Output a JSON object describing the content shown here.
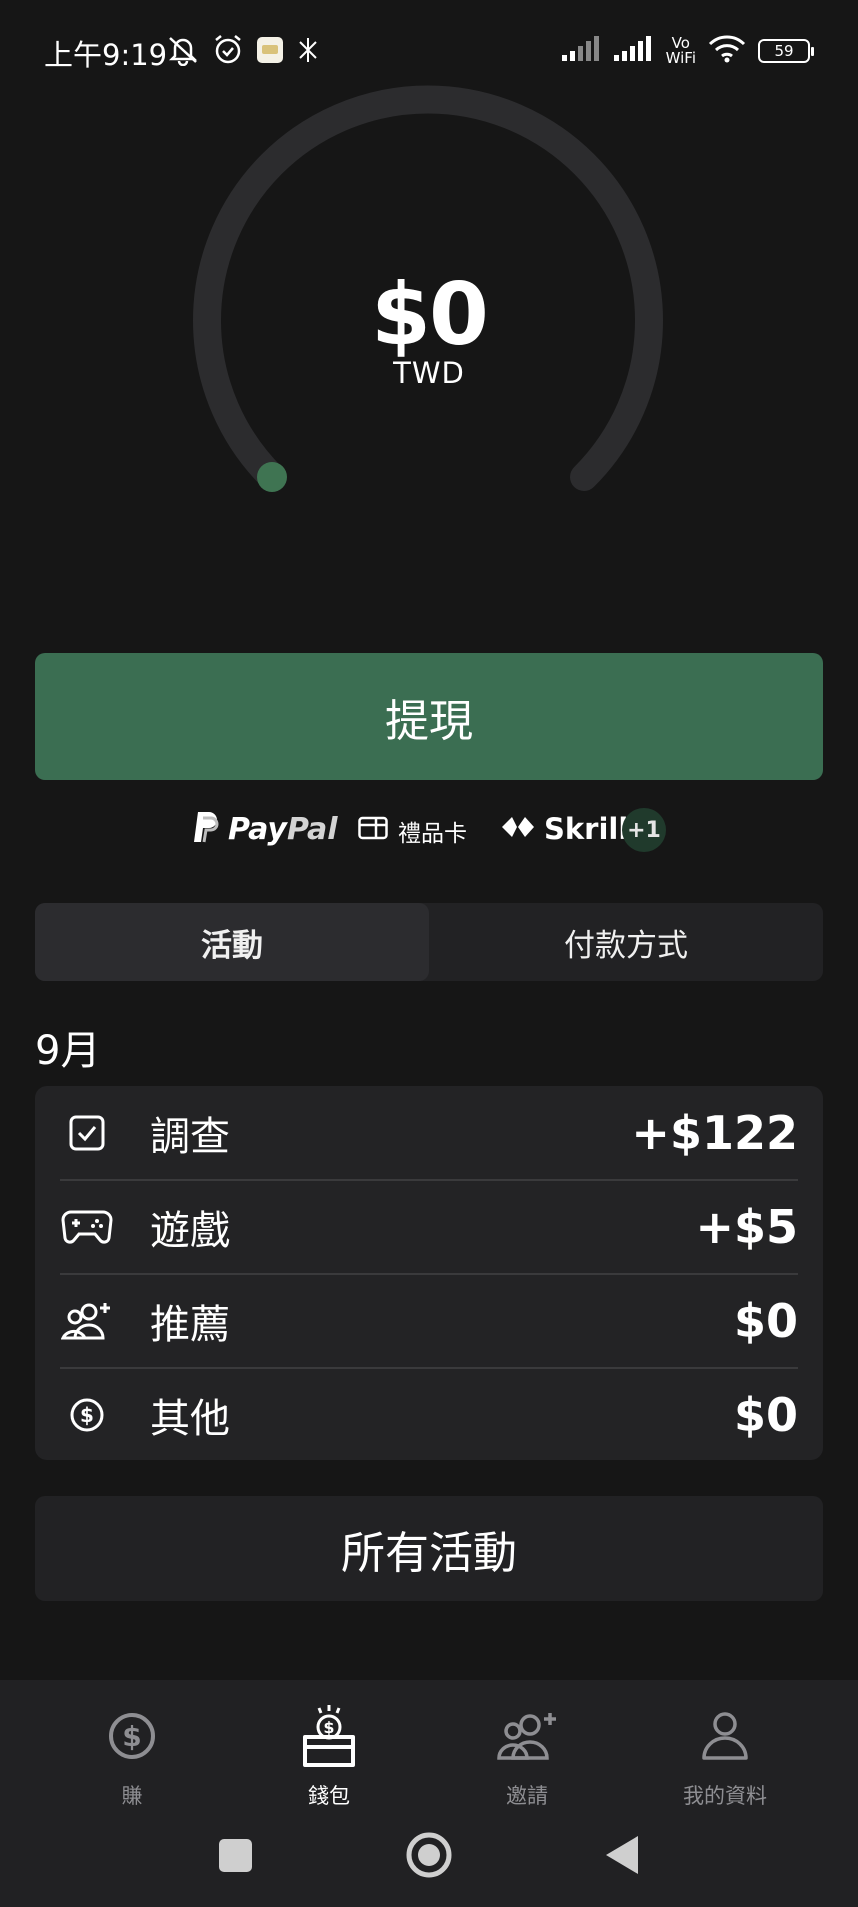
{
  "status_bar": {
    "time": "上午9:19",
    "vo_label": "Vo",
    "wifi_label": "WiFi",
    "battery": "59",
    "icons": [
      "mute-icon",
      "alarm-icon",
      "app-notification-icon",
      "nfc-icon",
      "signal-icon",
      "wifi-icon",
      "battery-icon"
    ]
  },
  "balance": {
    "amount": "$0",
    "currency": "TWD",
    "progress": 0
  },
  "withdraw_label": "提現",
  "payment_methods": {
    "paypal_pay": "Pay",
    "paypal_pal": "Pal",
    "giftcard": "禮品卡",
    "skrill": "Skrill",
    "more": "+1"
  },
  "tabs": [
    {
      "label": "活動",
      "active": true
    },
    {
      "label": "付款方式",
      "active": false
    }
  ],
  "month": "9月",
  "activity": [
    {
      "icon": "checkbox-icon",
      "label": "調查",
      "amount": "+$122"
    },
    {
      "icon": "gamepad-icon",
      "label": "遊戲",
      "amount": "+$5"
    },
    {
      "icon": "referral-icon",
      "label": "推薦",
      "amount": "$0"
    },
    {
      "icon": "dollar-coin-icon",
      "label": "其他",
      "amount": "$0"
    }
  ],
  "all_activity_label": "所有活動",
  "bottom_nav": [
    {
      "label": "賺",
      "icon": "dollar-coin-icon",
      "active": false
    },
    {
      "label": "錢包",
      "icon": "wallet-icon",
      "active": true
    },
    {
      "label": "邀請",
      "icon": "invite-icon",
      "active": false
    },
    {
      "label": "我的資料",
      "icon": "profile-icon",
      "active": false
    }
  ],
  "colors": {
    "background": "#161616",
    "accent": "#3b6e52",
    "card": "#232325",
    "gauge_track": "#2c2c2e",
    "gauge_dot": "#3f7452"
  }
}
